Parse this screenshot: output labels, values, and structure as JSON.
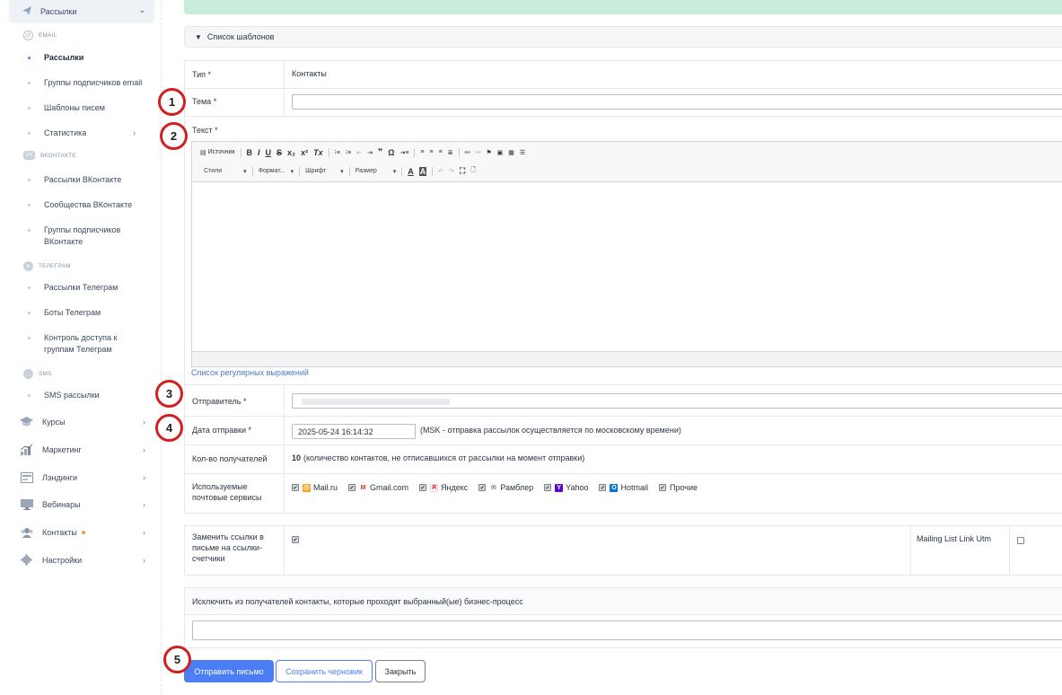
{
  "sidebar": {
    "open_menu": {
      "label": "Рассылки",
      "icon": "paper-plane-icon"
    },
    "sections": [
      {
        "label": "EMAIL",
        "icon": "at-icon"
      },
      {
        "label": "ВКОНТАКТЕ",
        "icon": "vk-icon"
      },
      {
        "label": "ТЕЛЕГРАМ",
        "icon": "telegram-icon"
      },
      {
        "label": "SMS",
        "icon": "sms-icon"
      }
    ],
    "items": [
      {
        "label": "Рассылки"
      },
      {
        "label": "Группы подписчиков email"
      },
      {
        "label": "Шаблоны писем"
      },
      {
        "label": "Статистика"
      },
      {
        "label": "Рассылки ВКонтакте"
      },
      {
        "label": "Сообщества ВКонтакте"
      },
      {
        "label": "Группы подписчиков ВКонтакте"
      },
      {
        "label": "Рассылки Телеграм"
      },
      {
        "label": "Боты Телеграм"
      },
      {
        "label": "Контроль доступа к группам Телеграм"
      },
      {
        "label": "SMS рассылки"
      }
    ],
    "menus": [
      {
        "label": "Курсы",
        "icon": "graduation-cap-icon"
      },
      {
        "label": "Маркетинг",
        "icon": "chart-icon"
      },
      {
        "label": "Лэндинги",
        "icon": "landing-icon"
      },
      {
        "label": "Вебинары",
        "icon": "monitor-icon"
      },
      {
        "label": "Контакты",
        "icon": "contacts-icon"
      },
      {
        "label": "Настройки",
        "icon": "gear-icon"
      }
    ]
  },
  "templates_bar": {
    "label": "Список шаблонов",
    "icon": "triangle-down-icon"
  },
  "form": {
    "type_label": "Тип *",
    "type_value": "Контакты",
    "subject_label": "Тема *",
    "subject_value": "",
    "text_label": "Текст *",
    "regex_link": "Список регулярных выражений",
    "sender_label": "Отправитель *",
    "date_label": "Дата отправки *",
    "date_value": "2025-05-24 16:14:32",
    "date_note": "(MSK - отправка рассылок осуществляется по московскому времени)",
    "recipients_label": "Кол-во получателей",
    "recipients_count": "10",
    "recipients_note": "(количество контактов, не отписавшихся от рассылки на момент отправки)",
    "services_label": "Используемые почтовые сервисы",
    "services": [
      {
        "name": "Mail.ru",
        "icon": "mailru-icon",
        "color": "#f5a623"
      },
      {
        "name": "Gmail.com",
        "icon": "gmail-icon",
        "color": "#d93025"
      },
      {
        "name": "Яндекс",
        "icon": "yandex-icon",
        "color": "#e31e24"
      },
      {
        "name": "Рамблер",
        "icon": "rambler-icon",
        "color": "#333333"
      },
      {
        "name": "Yahoo",
        "icon": "yahoo-icon",
        "color": "#5f01d1"
      },
      {
        "name": "Hotmail",
        "icon": "hotmail-icon",
        "color": "#0078d4"
      },
      {
        "name": "Прочие",
        "icon": "",
        "color": ""
      }
    ],
    "replace_links_label": "Заменить ссылки в письме на ссылки-счетчики",
    "utm_label": "Mailing List Link Utm",
    "exclude_label": "Исключить из получателей контакты, которые проходят выбранный(ые) бизнес-процесс"
  },
  "editor": {
    "source_label": "Источник",
    "styles_label": "Стили",
    "format_label": "Формат...",
    "font_label": "Шрифт",
    "size_label": "Размер"
  },
  "buttons": {
    "send": "Отправить письмо",
    "save_draft": "Сохранить черновик",
    "close": "Закрыть"
  },
  "markers": [
    "1",
    "2",
    "3",
    "4",
    "5"
  ],
  "colors": {
    "primary": "#4b7df5",
    "marker": "#d21f1f",
    "alert": "#c8ecd9"
  }
}
